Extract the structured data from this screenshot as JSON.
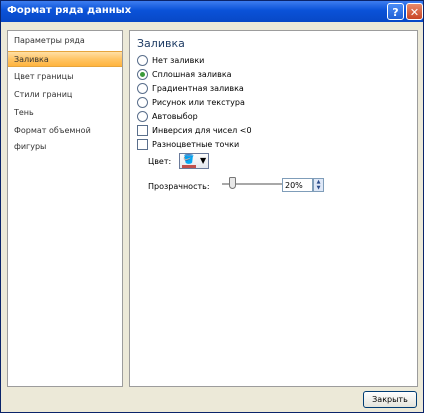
{
  "window": {
    "title": "Формат ряда данных",
    "help_label": "?",
    "close_label": "✕"
  },
  "sidebar": {
    "items": [
      {
        "label": "Параметры ряда"
      },
      {
        "label": "Заливка"
      },
      {
        "label": "Цвет границы"
      },
      {
        "label": "Стили границ"
      },
      {
        "label": "Тень"
      },
      {
        "label": "Формат объемной фигуры"
      }
    ]
  },
  "panel": {
    "title": "Заливка",
    "radio_options": [
      {
        "label": "Нет заливки",
        "selected": false
      },
      {
        "label": "Сплошная заливка",
        "selected": true
      },
      {
        "label": "Градиентная заливка",
        "selected": false
      },
      {
        "label": "Рисунок или текстура",
        "selected": false
      },
      {
        "label": "Автовыбор",
        "selected": false
      }
    ],
    "checkboxes": [
      {
        "label": "Инверсия для чисел <0",
        "checked": false
      },
      {
        "label": "Разноцветные точки",
        "checked": false
      }
    ],
    "color_label": "Цвет:",
    "color_value": "#c0504d",
    "transparency_label": "Прозрачность:",
    "transparency_value": "20%",
    "transparency_level": 0.2
  },
  "footer": {
    "close_button": "Закрыть"
  }
}
